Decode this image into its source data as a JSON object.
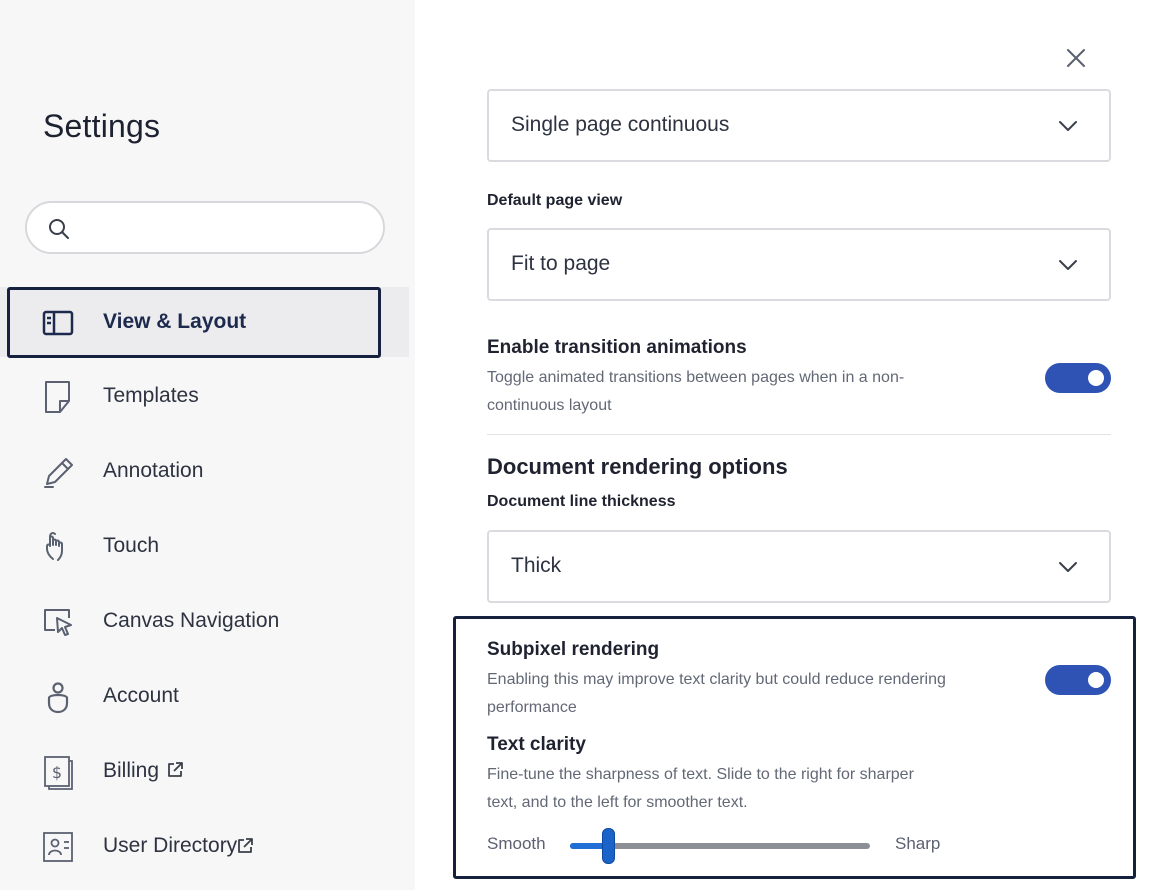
{
  "sidebar": {
    "title": "Settings",
    "search": {
      "placeholder": "",
      "value": ""
    },
    "items": [
      {
        "label": "View & Layout",
        "icon": "layout-panel-icon",
        "active": true
      },
      {
        "label": "Templates",
        "icon": "template-page-icon"
      },
      {
        "label": "Annotation",
        "icon": "pencil-icon"
      },
      {
        "label": "Touch",
        "icon": "touch-hand-icon"
      },
      {
        "label": "Canvas Navigation",
        "icon": "canvas-pointer-icon"
      },
      {
        "label": "Account",
        "icon": "account-person-icon"
      },
      {
        "label": "Billing",
        "icon": "billing-dollar-icon",
        "external": true
      },
      {
        "label": "User Directory",
        "icon": "user-directory-icon",
        "external": true
      }
    ]
  },
  "main": {
    "page_layout_select": {
      "value": "Single page continuous"
    },
    "default_page_view": {
      "label": "Default page view",
      "value": "Fit to page"
    },
    "transition_animations": {
      "title": "Enable transition animations",
      "description": "Toggle animated transitions between pages when in a non-continuous layout",
      "enabled": true
    },
    "rendering_heading": "Document rendering options",
    "line_thickness": {
      "label": "Document line thickness",
      "value": "Thick"
    },
    "subpixel_rendering": {
      "title": "Subpixel rendering",
      "description": "Enabling this may improve text clarity but could reduce rendering performance",
      "enabled": true
    },
    "text_clarity": {
      "title": "Text clarity",
      "description": "Fine-tune the sharpness of text. Slide to the right for sharper text, and to the left for smoother text.",
      "min_label": "Smooth",
      "max_label": "Sharp",
      "value": 0.125
    }
  },
  "colors": {
    "accent": "#2f53b5",
    "focus_ring": "#16213f",
    "slider_fill": "#1f6fd6",
    "sidebar_bg": "#f7f7f8"
  }
}
